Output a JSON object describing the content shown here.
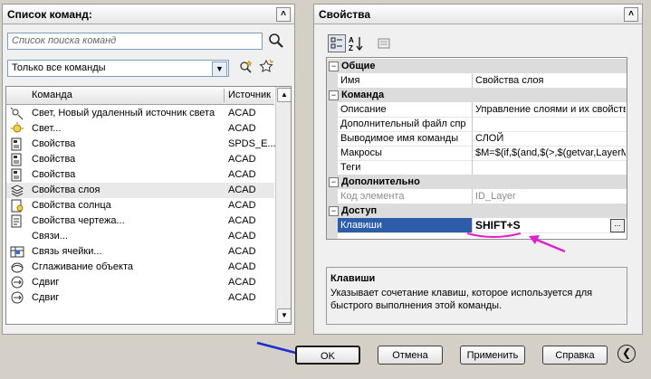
{
  "left_panel": {
    "title": "Список команд:",
    "search_placeholder": "Список поиска команд",
    "filter_selected": "Только все команды",
    "columns": {
      "command": "Команда",
      "source": "Источник"
    },
    "rows": [
      {
        "name": "Свет, Новый удаленный источник света",
        "source": "ACAD",
        "icon": "light-icon"
      },
      {
        "name": "Свет...",
        "source": "ACAD",
        "icon": "light-bulb-icon"
      },
      {
        "name": "Свойства",
        "source": "SPDS_E...",
        "icon": "properties-icon"
      },
      {
        "name": "Свойства",
        "source": "ACAD",
        "icon": "properties-icon"
      },
      {
        "name": "Свойства",
        "source": "ACAD",
        "icon": "properties-icon"
      },
      {
        "name": "Свойства слоя",
        "source": "ACAD",
        "icon": "layer-properties-icon"
      },
      {
        "name": "Свойства солнца",
        "source": "ACAD",
        "icon": "sun-properties-icon"
      },
      {
        "name": "Свойства чертежа...",
        "source": "ACAD",
        "icon": "drawing-properties-icon"
      },
      {
        "name": "Связи...",
        "source": "ACAD",
        "icon": ""
      },
      {
        "name": "Связь ячейки...",
        "source": "ACAD",
        "icon": "cell-link-icon"
      },
      {
        "name": "Сглаживание объекта",
        "source": "ACAD",
        "icon": "smooth-object-icon"
      },
      {
        "name": "Сдвиг",
        "source": "ACAD",
        "icon": "move-icon"
      },
      {
        "name": "Сдвиг",
        "source": "ACAD",
        "icon": "move-icon"
      }
    ]
  },
  "right_panel": {
    "title": "Свойства",
    "groups": [
      {
        "label": "Общие",
        "rows": [
          {
            "key": "Имя",
            "value": "Свойства слоя"
          }
        ]
      },
      {
        "label": "Команда",
        "rows": [
          {
            "key": "Описание",
            "value": "Управление слоями и их свойств"
          },
          {
            "key": "Дополнительный файл спр",
            "value": ""
          },
          {
            "key": "Выводимое имя команды",
            "value": "СЛОЙ"
          },
          {
            "key": "Макросы",
            "value": "$M=$(if,$(and,$(>,$(getvar,LayerMa"
          },
          {
            "key": "Теги",
            "value": ""
          }
        ]
      },
      {
        "label": "Дополнительно",
        "rows": [
          {
            "key": "Код элемента",
            "value": "ID_Layer"
          }
        ]
      },
      {
        "label": "Доступ",
        "rows": [
          {
            "key": "Клавиши",
            "value": "SHIFT+S"
          }
        ]
      }
    ],
    "ellipsis": "...",
    "description": {
      "title": "Клавиши",
      "text": "Указывает сочетание клавиш, которое используется для быстрого выполнения этой команды."
    }
  },
  "buttons": {
    "ok": "OK",
    "cancel": "Отмена",
    "apply": "Применить",
    "help": "Справка"
  },
  "colors": {
    "accent_selection": "#2b5da8",
    "annotation_arrow_pink": "#e020d0",
    "annotation_arrow_blue": "#1a2fd0"
  }
}
